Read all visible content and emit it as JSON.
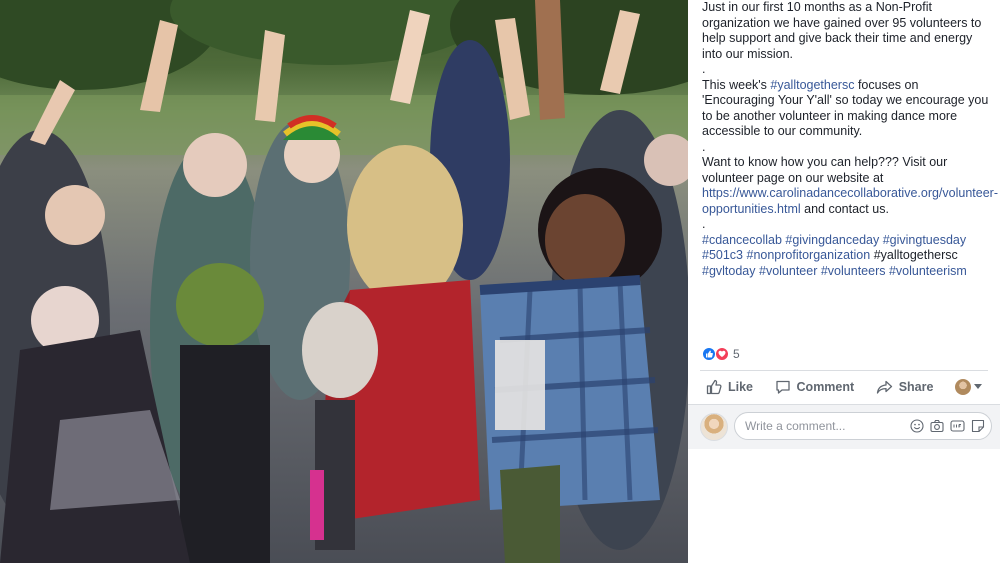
{
  "post": {
    "paragraph1": "Just in our first 10 months as a Non-Profit organization we have gained over 95 volunteers to help support and give back their time and energy into our mission.",
    "dot1": ".",
    "p2_prefix": "This week's ",
    "p2_hashtag": "#yalltogethersc",
    "p2_suffix": " focuses on 'Encouraging Your Y'all' so today we encourage you to be another volunteer in making dance more accessible to our community.",
    "dot2": ".",
    "p3_prefix": "Want to know how you can help??? Visit our volunteer page on our website at ",
    "p3_link": "https://www.carolinadancecollaborative.org/volunteer-opportunities.html",
    "p3_suffix": " and contact us.",
    "dot3": ".",
    "tags": [
      {
        "text": "#cdancecollab",
        "linked": true
      },
      {
        "text": "#givingdanceday",
        "linked": true
      },
      {
        "text": "#givingtuesday",
        "linked": true
      },
      {
        "text": "#501c3",
        "linked": true
      },
      {
        "text": "#nonprofitorganization",
        "linked": true
      },
      {
        "text": "#yalltogethersc",
        "linked": false
      },
      {
        "text": "#gvltoday",
        "linked": true
      },
      {
        "text": "#volunteer",
        "linked": true
      },
      {
        "text": "#volunteers",
        "linked": true
      },
      {
        "text": "#volunteerism",
        "linked": true
      }
    ]
  },
  "reactions": {
    "count": "5",
    "icons": [
      "like-reaction-icon",
      "love-reaction-icon"
    ]
  },
  "actions": {
    "like_label": "Like",
    "comment_label": "Comment",
    "share_label": "Share"
  },
  "comment_box": {
    "placeholder": "Write a comment...",
    "icons": [
      "emoji-icon",
      "camera-icon",
      "gif-icon",
      "sticker-icon"
    ]
  },
  "colors": {
    "link": "#385898",
    "text": "#1d2129",
    "muted": "#606770",
    "like_blue": "#1877f2",
    "love_red": "#f33e58"
  }
}
